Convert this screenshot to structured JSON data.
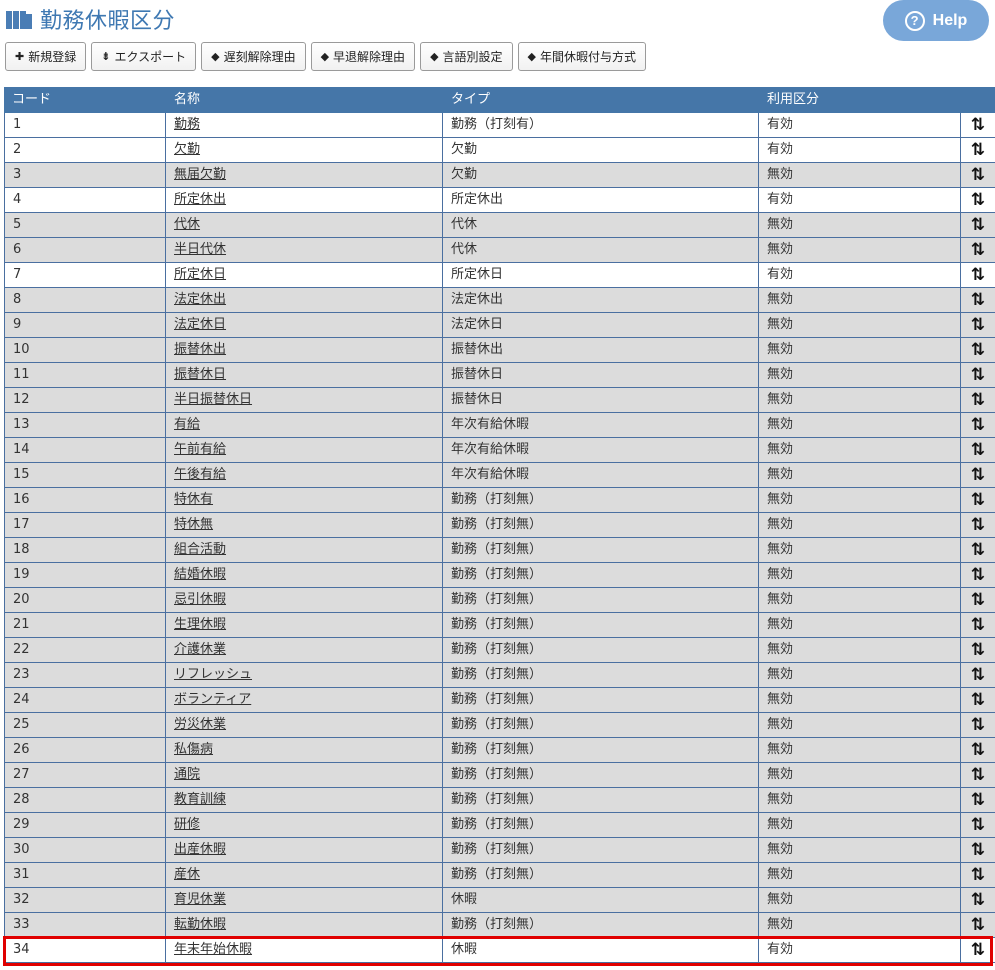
{
  "page": {
    "title": "勤務休暇区分",
    "help_label": "Help"
  },
  "toolbar": [
    {
      "icon": "plus-icon",
      "glyph": "✚",
      "label": "新規登録"
    },
    {
      "icon": "export-icon",
      "glyph": "⇟",
      "label": "エクスポート"
    },
    {
      "icon": "tag-icon",
      "glyph": "◆",
      "label": "遅刻解除理由"
    },
    {
      "icon": "tag-icon",
      "glyph": "◆",
      "label": "早退解除理由"
    },
    {
      "icon": "tag-icon",
      "glyph": "◆",
      "label": "言語別設定"
    },
    {
      "icon": "tag-icon",
      "glyph": "◆",
      "label": "年間休暇付与方式"
    }
  ],
  "table": {
    "headers": [
      "コード",
      "名称",
      "タイプ",
      "利用区分"
    ],
    "sort_glyph": "⇅",
    "highlight_color": "#e00000",
    "rows": [
      {
        "code": "1",
        "name": "勤務",
        "type": "勤務（打刻有）",
        "use": "有効"
      },
      {
        "code": "2",
        "name": "欠勤",
        "type": "欠勤",
        "use": "有効"
      },
      {
        "code": "3",
        "name": "無届欠勤",
        "type": "欠勤",
        "use": "無効"
      },
      {
        "code": "4",
        "name": "所定休出",
        "type": "所定休出",
        "use": "有効"
      },
      {
        "code": "5",
        "name": "代休",
        "type": "代休",
        "use": "無効"
      },
      {
        "code": "6",
        "name": "半日代休",
        "type": "代休",
        "use": "無効"
      },
      {
        "code": "7",
        "name": "所定休日",
        "type": "所定休日",
        "use": "有効"
      },
      {
        "code": "8",
        "name": "法定休出",
        "type": "法定休出",
        "use": "無効"
      },
      {
        "code": "9",
        "name": "法定休日",
        "type": "法定休日",
        "use": "無効"
      },
      {
        "code": "10",
        "name": "振替休出",
        "type": "振替休出",
        "use": "無効"
      },
      {
        "code": "11",
        "name": "振替休日",
        "type": "振替休日",
        "use": "無効"
      },
      {
        "code": "12",
        "name": "半日振替休日",
        "type": "振替休日",
        "use": "無効"
      },
      {
        "code": "13",
        "name": "有給",
        "type": "年次有給休暇",
        "use": "無効"
      },
      {
        "code": "14",
        "name": "午前有給",
        "type": "年次有給休暇",
        "use": "無効"
      },
      {
        "code": "15",
        "name": "午後有給",
        "type": "年次有給休暇",
        "use": "無効"
      },
      {
        "code": "16",
        "name": "特休有",
        "type": "勤務（打刻無）",
        "use": "無効"
      },
      {
        "code": "17",
        "name": "特休無",
        "type": "勤務（打刻無）",
        "use": "無効"
      },
      {
        "code": "18",
        "name": "組合活動",
        "type": "勤務（打刻無）",
        "use": "無効"
      },
      {
        "code": "19",
        "name": "結婚休暇",
        "type": "勤務（打刻無）",
        "use": "無効"
      },
      {
        "code": "20",
        "name": "忌引休暇",
        "type": "勤務（打刻無）",
        "use": "無効"
      },
      {
        "code": "21",
        "name": "生理休暇",
        "type": "勤務（打刻無）",
        "use": "無効"
      },
      {
        "code": "22",
        "name": "介護休業",
        "type": "勤務（打刻無）",
        "use": "無効"
      },
      {
        "code": "23",
        "name": "リフレッシュ",
        "type": "勤務（打刻無）",
        "use": "無効"
      },
      {
        "code": "24",
        "name": "ボランティア",
        "type": "勤務（打刻無）",
        "use": "無効"
      },
      {
        "code": "25",
        "name": "労災休業",
        "type": "勤務（打刻無）",
        "use": "無効"
      },
      {
        "code": "26",
        "name": "私傷病",
        "type": "勤務（打刻無）",
        "use": "無効"
      },
      {
        "code": "27",
        "name": "通院",
        "type": "勤務（打刻無）",
        "use": "無効"
      },
      {
        "code": "28",
        "name": "教育訓練",
        "type": "勤務（打刻無）",
        "use": "無効"
      },
      {
        "code": "29",
        "name": "研修",
        "type": "勤務（打刻無）",
        "use": "無効"
      },
      {
        "code": "30",
        "name": "出産休暇",
        "type": "勤務（打刻無）",
        "use": "無効"
      },
      {
        "code": "31",
        "name": "産休",
        "type": "勤務（打刻無）",
        "use": "無効"
      },
      {
        "code": "32",
        "name": "育児休業",
        "type": "休暇",
        "use": "無効"
      },
      {
        "code": "33",
        "name": "転勤休暇",
        "type": "勤務（打刻無）",
        "use": "無効"
      },
      {
        "code": "34",
        "name": "年末年始休暇",
        "type": "休暇",
        "use": "有効"
      }
    ]
  }
}
